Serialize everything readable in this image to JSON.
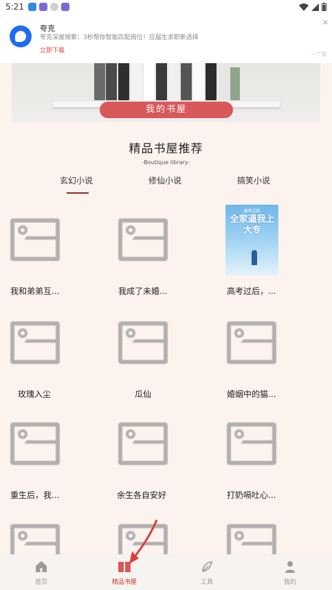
{
  "status_bar": {
    "time": "5:21"
  },
  "ad": {
    "title": "夸克",
    "description": "夸克深度搜索：3秒帮你智能匹配岗位！应届生求职新选择",
    "cta": "立即下载",
    "tag": "广告",
    "close": "×"
  },
  "hero": {
    "badge": "我的书屋"
  },
  "section": {
    "title": "精品书屋推荐",
    "subtitle": "-Boutique library-"
  },
  "tabs": [
    {
      "label": "玄幻小说"
    },
    {
      "label": "修仙小说"
    },
    {
      "label": "搞笑小说"
    }
  ],
  "books": [
    {
      "title": "我和弟弟互..."
    },
    {
      "title": "我成了未婚..."
    },
    {
      "title": "高考过后，...",
      "cover_small": "高考过后",
      "cover_big": "全家逼我上大专"
    },
    {
      "title": "玫瑰入尘"
    },
    {
      "title": "瓜仙"
    },
    {
      "title": "婚姻中的猫..."
    },
    {
      "title": "重生后，我..."
    },
    {
      "title": "余生各自安好"
    },
    {
      "title": "打奶嗝吐心..."
    }
  ],
  "nav": [
    {
      "label": "首页",
      "icon": "home-icon"
    },
    {
      "label": "精品书屋",
      "icon": "book-icon"
    },
    {
      "label": "工具",
      "icon": "leaf-icon"
    },
    {
      "label": "我的",
      "icon": "user-icon"
    }
  ],
  "colors": {
    "accent": "#c0392b",
    "badge": "#d9585a",
    "ad_brand": "#1e6bf5"
  }
}
